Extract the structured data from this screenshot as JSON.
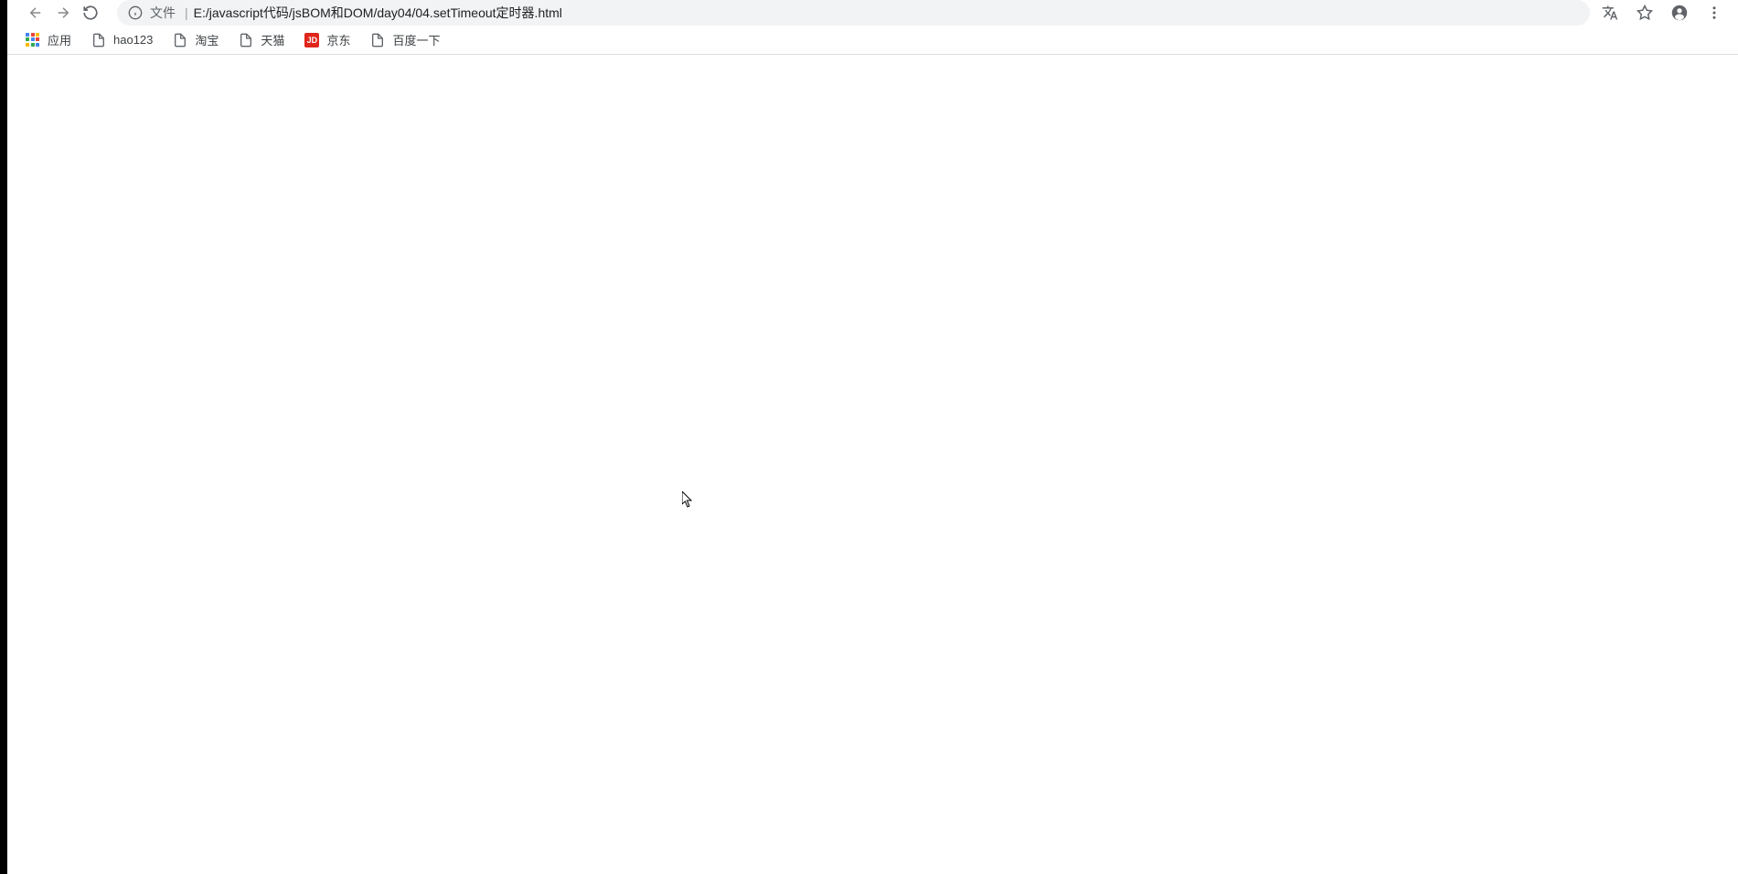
{
  "address": {
    "prefix": "文件",
    "path": "E:/javascript代码/jsBOM和DOM/day04/04.setTimeout定时器.html"
  },
  "bookmarks": [
    {
      "label": "应用",
      "icon": "apps-grid"
    },
    {
      "label": "hao123",
      "icon": "file"
    },
    {
      "label": "淘宝",
      "icon": "file"
    },
    {
      "label": "天猫",
      "icon": "file"
    },
    {
      "label": "京东",
      "icon": "jd"
    },
    {
      "label": "百度一下",
      "icon": "file"
    }
  ],
  "apps_colors": [
    "#4285f4",
    "#ea4335",
    "#fbbc05",
    "#34a853",
    "#4285f4",
    "#ea4335",
    "#fbbc05",
    "#34a853",
    "#4285f4"
  ],
  "jd_text": "JD"
}
